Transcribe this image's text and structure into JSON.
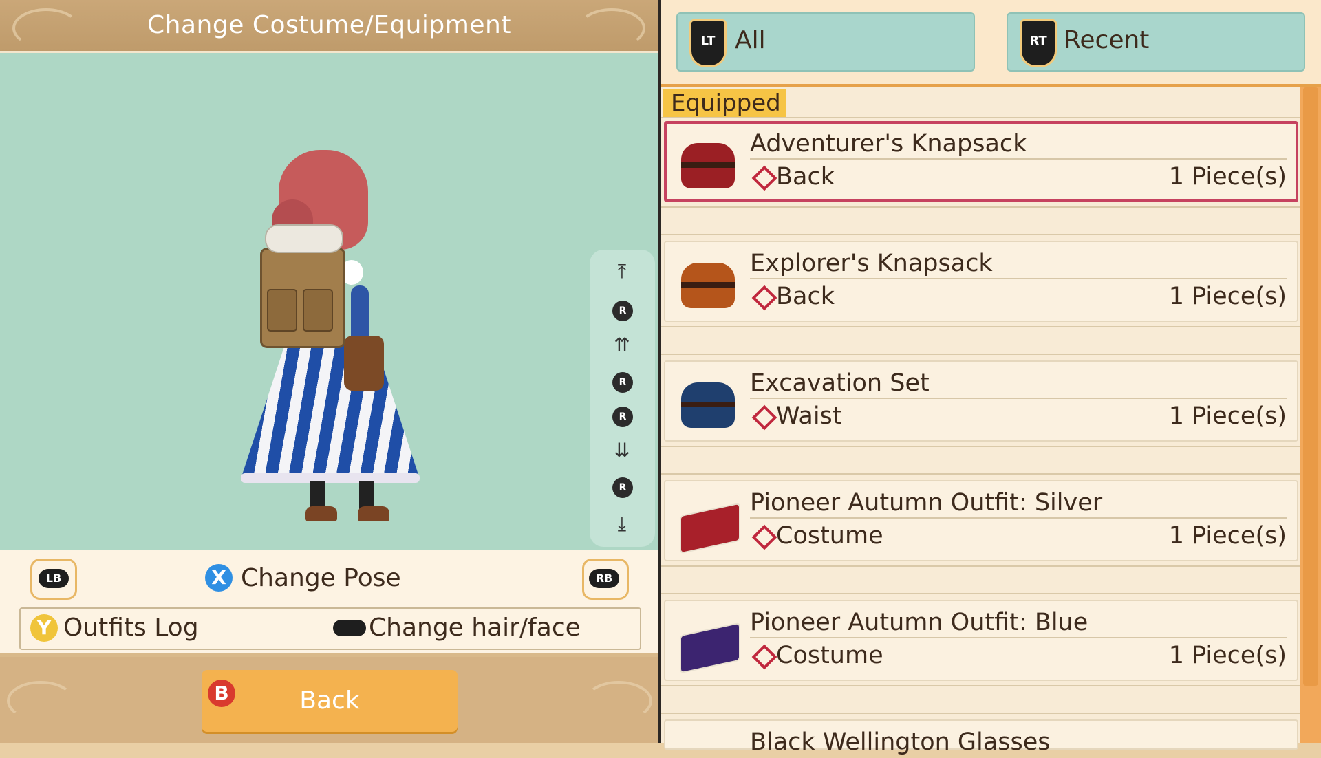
{
  "header": {
    "title": "Change Costume/Equipment"
  },
  "controls": {
    "lb_label": "LB",
    "rb_label": "RB",
    "pose_button": "X",
    "pose_label": "Change Pose",
    "log_button": "Y",
    "log_label": "Outfits Log",
    "hair_label": "Change hair/face",
    "stick_label": "R"
  },
  "footer": {
    "back_button": "B",
    "back_label": "Back"
  },
  "tabs": [
    {
      "button": "LT",
      "label": "All"
    },
    {
      "button": "RT",
      "label": "Recent"
    }
  ],
  "list": {
    "section_label": "Equipped",
    "items": [
      {
        "name": "Adventurer's Knapsack",
        "slot": "Back",
        "qty": "1 Piece(s)",
        "color": "#9b1f24",
        "selected": true
      },
      {
        "name": "Explorer's Knapsack",
        "slot": "Back",
        "qty": "1 Piece(s)",
        "color": "#b5551b",
        "selected": false
      },
      {
        "name": "Excavation Set",
        "slot": "Waist",
        "qty": "1 Piece(s)",
        "color": "#1f3f6e",
        "selected": false
      },
      {
        "name": "Pioneer Autumn Outfit: Silver",
        "slot": "Costume",
        "qty": "1 Piece(s)",
        "color": "#a8202a",
        "selected": false
      },
      {
        "name": "Pioneer Autumn Outfit: Blue",
        "slot": "Costume",
        "qty": "1 Piece(s)",
        "color": "#3c2470",
        "selected": false
      },
      {
        "name": "Black Wellington Glasses",
        "slot": "",
        "qty": "",
        "color": "#333333",
        "selected": false
      }
    ]
  },
  "colors": {
    "accent": "#e6a14a",
    "selected_border": "#c6425f",
    "viewport_bg": "#aed7c5",
    "tab_bg": "#a9d6cc",
    "back_button": "#f4b24f"
  }
}
